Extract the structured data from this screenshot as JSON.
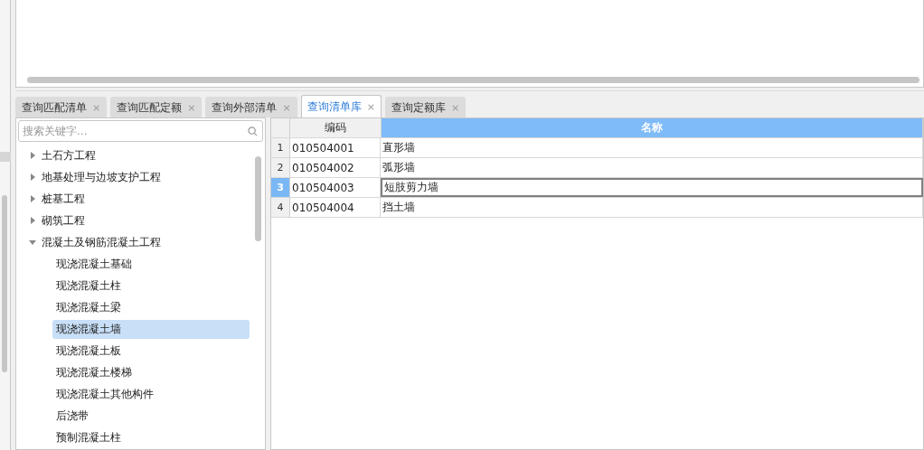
{
  "tabs": [
    {
      "label": "查询匹配清单",
      "close": "×",
      "selected": false
    },
    {
      "label": "查询匹配定额",
      "close": "×",
      "selected": false
    },
    {
      "label": "查询外部清单",
      "close": "×",
      "selected": false
    },
    {
      "label": "查询清单库",
      "close": "×",
      "selected": true
    },
    {
      "label": "查询定额库",
      "close": "×",
      "selected": false
    }
  ],
  "search": {
    "placeholder": "搜索关键字..."
  },
  "tree": [
    {
      "label": "土石方工程",
      "expanded": false,
      "selected": false
    },
    {
      "label": "地基处理与边坡支护工程",
      "expanded": false,
      "selected": false
    },
    {
      "label": "桩基工程",
      "expanded": false,
      "selected": false
    },
    {
      "label": "砌筑工程",
      "expanded": false,
      "selected": false
    },
    {
      "label": "混凝土及钢筋混凝土工程",
      "expanded": true,
      "selected": false,
      "children": [
        {
          "label": "现浇混凝土基础",
          "selected": false
        },
        {
          "label": "现浇混凝土柱",
          "selected": false
        },
        {
          "label": "现浇混凝土梁",
          "selected": false
        },
        {
          "label": "现浇混凝土墙",
          "selected": true
        },
        {
          "label": "现浇混凝土板",
          "selected": false
        },
        {
          "label": "现浇混凝土楼梯",
          "selected": false
        },
        {
          "label": "现浇混凝土其他构件",
          "selected": false
        },
        {
          "label": "后浇带",
          "selected": false
        },
        {
          "label": "预制混凝土柱",
          "selected": false
        }
      ]
    }
  ],
  "table": {
    "columns": [
      {
        "label": "编码",
        "selected": false
      },
      {
        "label": "名称",
        "selected": true
      }
    ],
    "rows": [
      {
        "index": "1",
        "code": "010504001",
        "name": "直形墙",
        "selected": false
      },
      {
        "index": "2",
        "code": "010504002",
        "name": "弧形墙",
        "selected": false
      },
      {
        "index": "3",
        "code": "010504003",
        "name": "短肢剪力墙",
        "selected": true
      },
      {
        "index": "4",
        "code": "010504004",
        "name": "挡土墙",
        "selected": false
      }
    ]
  }
}
